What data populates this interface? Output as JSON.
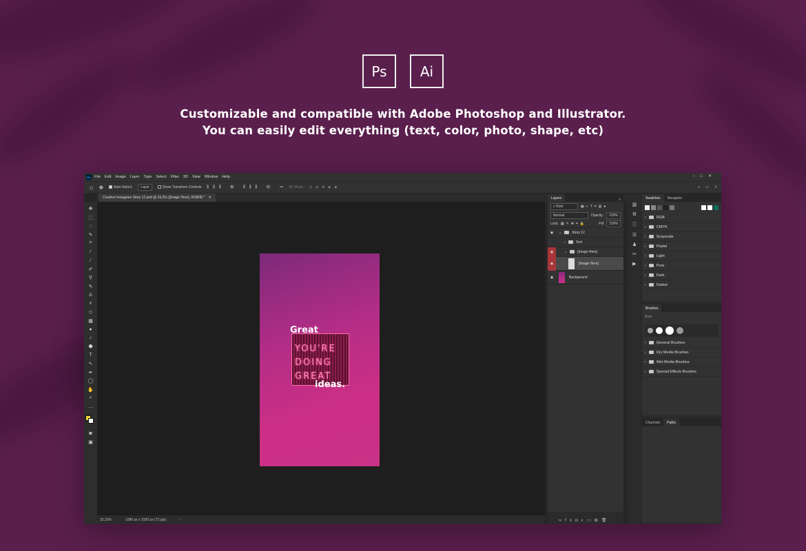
{
  "colors": {
    "background": "#5a1f4d",
    "accent_fg": "#f5d63c"
  },
  "logos": [
    {
      "label": "Ps",
      "icon": "photoshop-logo-icon"
    },
    {
      "label": "Ai",
      "icon": "illustrator-logo-icon"
    }
  ],
  "tagline": {
    "line1": "Customizable and compatible with Adobe Photoshop and Illustrator.",
    "line2": "You can easily edit everything (text, color, photo, shape, etc)"
  },
  "photoshop": {
    "menu": [
      "File",
      "Edit",
      "Image",
      "Layer",
      "Type",
      "Select",
      "Filter",
      "3D",
      "View",
      "Window",
      "Help"
    ],
    "options": {
      "auto_select_label": "Auto-Select:",
      "auto_select_value": "Layer",
      "transform_label": "Show Transform Controls",
      "mode_3d": "3D Mode:"
    },
    "doc_tab": "Creative Instagram Story 12.psd @ 33,3% ([Image Here], RGB/8) *",
    "status": {
      "zoom": "33,33%",
      "doc_size": "1080 px x 1920 px (72 ppi)"
    },
    "story": {
      "top_word": "Great",
      "neon_lines": [
        "YOU'RE",
        "DOING",
        "GREAT"
      ],
      "bottom_word": "ideas."
    },
    "layers_panel": {
      "tab": "Layers",
      "kind_filter": "Kind",
      "blend_mode": "Normal",
      "opacity_label": "Opacity:",
      "opacity_value": "100%",
      "lock_label": "Lock:",
      "fill_label": "Fill:",
      "fill_value": "100%",
      "layers": [
        {
          "name": "Story 12"
        },
        {
          "name": "Text"
        },
        {
          "name": "[Image Here]"
        },
        {
          "name": "[Image Here]"
        },
        {
          "name": "Background"
        }
      ]
    },
    "swatches_panel": {
      "tabs": [
        "Swatches",
        "Navigator"
      ],
      "folders": [
        "RGB",
        "CMYK",
        "Grayscale",
        "Pastel",
        "Light",
        "Pure",
        "Dark",
        "Darker"
      ]
    },
    "brushes_panel": {
      "tab": "Brushes",
      "size_label": "Size:",
      "folders": [
        "General Brushes",
        "Dry Media Brushes",
        "Wet Media Brushes",
        "Special Effects Brushes"
      ]
    },
    "bottom_panel": {
      "tabs": [
        "Channels",
        "Paths"
      ]
    }
  }
}
